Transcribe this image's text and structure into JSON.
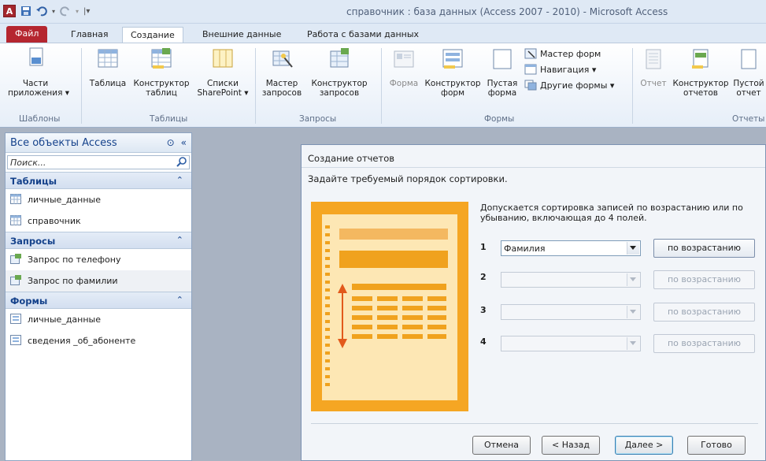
{
  "titlebar": {
    "title": "справочник : база данных (Access 2007 - 2010)  -  Microsoft Access",
    "app_logo": "A"
  },
  "tabs": [
    "Файл",
    "Главная",
    "Создание",
    "Внешние данные",
    "Работа с базами данных"
  ],
  "ribbon": {
    "templates": {
      "btn1": "Части",
      "btn1b": "приложения ▾",
      "group": "Шаблоны"
    },
    "tables": {
      "table": "Таблица",
      "constructor": "Конструктор",
      "constructor_b": "таблиц",
      "lists": "Списки",
      "lists_b": "SharePoint ▾",
      "group": "Таблицы"
    },
    "queries": {
      "wizard": "Мастер",
      "wizard_b": "запросов",
      "constructor": "Конструктор",
      "constructor_b": "запросов",
      "group": "Запросы"
    },
    "forms": {
      "form": "Форма",
      "constructor": "Конструктор",
      "constructor_b": "форм",
      "blank": "Пустая",
      "blank_b": "форма",
      "wizard": "Мастер форм",
      "navigation": "Навигация ▾",
      "other": "Другие формы ▾",
      "group": "Формы"
    },
    "reports": {
      "report": "Отчет",
      "constructor": "Конструктор",
      "constructor_b": "отчетов",
      "blank": "Пустой",
      "blank_b": "отчет",
      "group": "Отчеты"
    }
  },
  "nav": {
    "header": "Все объекты Access",
    "search_placeholder": "Поиск...",
    "sections": [
      {
        "title": "Таблицы",
        "items": [
          "личные_данные",
          "справочник"
        ]
      },
      {
        "title": "Запросы",
        "items": [
          "Запрос по телефону",
          "Запрос по фамилии"
        ]
      },
      {
        "title": "Формы",
        "items": [
          "личные_данные",
          "сведения _об_абоненте"
        ]
      }
    ]
  },
  "wizard": {
    "title": "Создание отчетов",
    "instruction": "Задайте требуемый порядок сортировки.",
    "hint": "Допускается сортировка записей по возрастанию или по убыванию, включающая до 4 полей.",
    "rows": [
      {
        "num": "1",
        "value": "Фамилия",
        "order": "по возрастанию"
      },
      {
        "num": "2",
        "value": "",
        "order": "по возрастанию"
      },
      {
        "num": "3",
        "value": "",
        "order": "по возрастанию"
      },
      {
        "num": "4",
        "value": "",
        "order": "по возрастанию"
      }
    ],
    "buttons": {
      "cancel": "Отмена",
      "back": "< Назад",
      "next": "Далее >",
      "finish": "Готово"
    }
  },
  "colors": {
    "file_tab": "#b5262f",
    "ribbon_bg": "#e6eef8",
    "nav_header_text": "#15428b",
    "workspace": "#a9b3c2",
    "illustration_orange": "#f5a623"
  }
}
